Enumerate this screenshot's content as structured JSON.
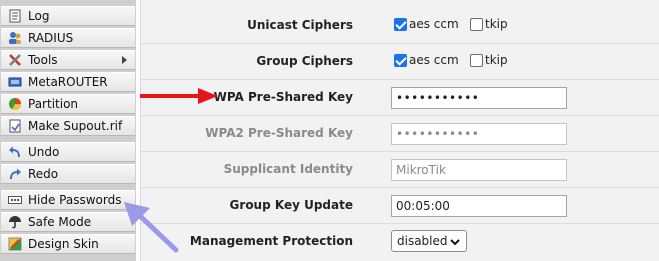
{
  "sidebar": {
    "items": [
      {
        "label": "Log",
        "icon": "log-icon"
      },
      {
        "label": "RADIUS",
        "icon": "radius-icon"
      },
      {
        "label": "Tools",
        "icon": "tools-icon",
        "submenu": true
      },
      {
        "label": "MetaROUTER",
        "icon": "metarouter-icon"
      },
      {
        "label": "Partition",
        "icon": "partition-icon"
      },
      {
        "label": "Make Supout.rif",
        "icon": "supout-icon"
      },
      {
        "label": "Undo",
        "icon": "undo-icon"
      },
      {
        "label": "Redo",
        "icon": "redo-icon"
      },
      {
        "label": "Hide Passwords",
        "icon": "hide-passwords-icon"
      },
      {
        "label": "Safe Mode",
        "icon": "safe-mode-icon"
      },
      {
        "label": "Design Skin",
        "icon": "design-skin-icon"
      }
    ]
  },
  "form": {
    "unicast_ciphers": {
      "label": "Unicast Ciphers",
      "opt1": "aes ccm",
      "opt1_checked": true,
      "opt2": "tkip",
      "opt2_checked": false
    },
    "group_ciphers": {
      "label": "Group Ciphers",
      "opt1": "aes ccm",
      "opt1_checked": true,
      "opt2": "tkip",
      "opt2_checked": false
    },
    "wpa_psk": {
      "label": "WPA Pre-Shared Key",
      "value": "•••••••••••"
    },
    "wpa2_psk": {
      "label": "WPA2 Pre-Shared Key",
      "value": "•••••••••••"
    },
    "supplicant_identity": {
      "label": "Supplicant Identity",
      "value": "MikroTik"
    },
    "group_key_update": {
      "label": "Group Key Update",
      "value": "00:05:00"
    },
    "management_protection": {
      "label": "Management Protection",
      "value": "disabled"
    }
  },
  "annotations": {
    "red_arrow_color": "#e8141b",
    "purple_arrow_color": "#9a9ae8"
  }
}
